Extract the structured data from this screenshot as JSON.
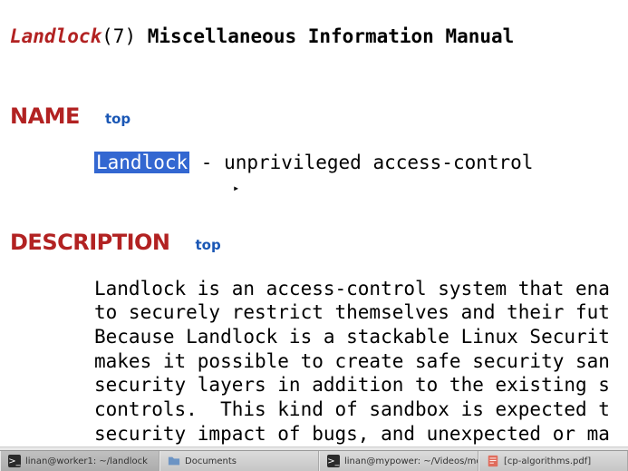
{
  "header": {
    "title": "Landlock",
    "section": "(7)",
    "manual": "Miscellaneous Information Manual"
  },
  "sections": {
    "name": {
      "heading": "NAME",
      "top_label": "top",
      "highlighted": "Landlock",
      "rest": " - unprivileged access-control"
    },
    "description": {
      "heading": "DESCRIPTION",
      "top_label": "top",
      "body": "Landlock is an access-control system that ena\nto securely restrict themselves and their fut\nBecause Landlock is a stackable Linux Securit\nmakes it possible to create safe security san\nsecurity layers in addition to the existing s\ncontrols.  This kind of sandbox is expected t\nsecurity impact of bugs, and unexpected or ma"
    }
  },
  "cursor": {
    "glyph": "▸"
  },
  "taskbar": {
    "items": [
      {
        "icon": "terminal",
        "label": "linan@worker1: ~/landlock"
      },
      {
        "icon": "files",
        "label": "Documents"
      },
      {
        "icon": "terminal",
        "label": "linan@mypower: ~/Videos/movies/..."
      },
      {
        "icon": "pdf",
        "label": "[cp-algorithms.pdf]"
      }
    ]
  }
}
